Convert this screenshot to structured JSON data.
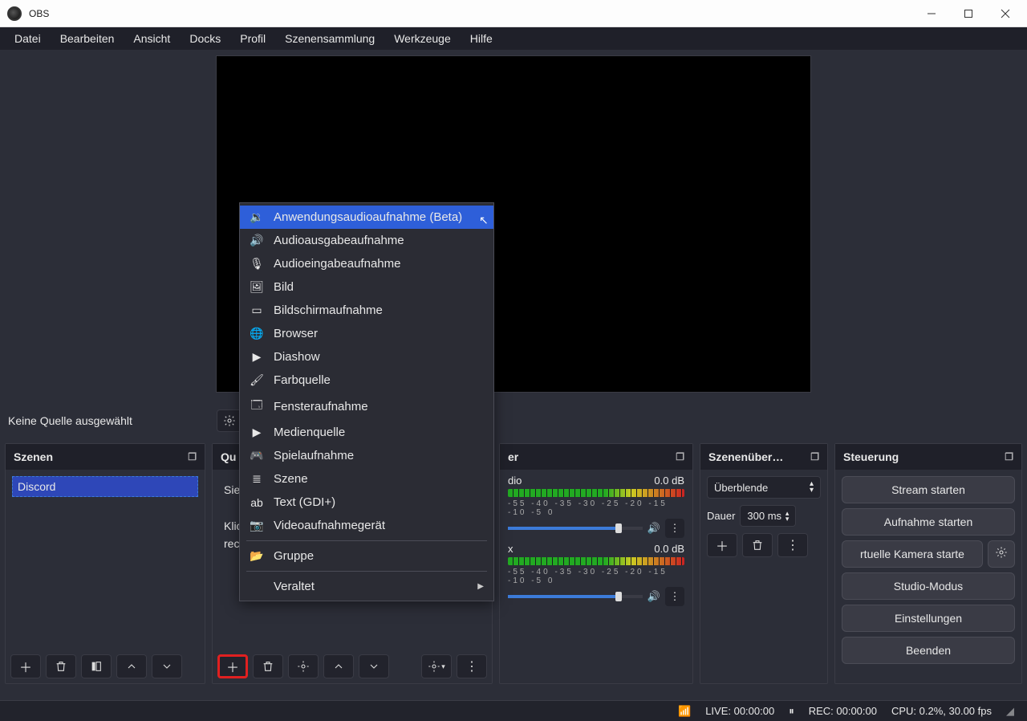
{
  "title": "OBS",
  "menubar": [
    "Datei",
    "Bearbeiten",
    "Ansicht",
    "Docks",
    "Profil",
    "Szenensammlung",
    "Werkzeuge",
    "Hilfe"
  ],
  "no_source_label": "Keine Quelle ausgewählt",
  "docks": {
    "scenes": {
      "title": "Szenen",
      "items": [
        "Discord"
      ]
    },
    "sources": {
      "title": "Qu",
      "hint_line1": "Sie",
      "hint_line2": "Klic",
      "hint_line3": "rec"
    },
    "mixer": {
      "title": "er",
      "channels": [
        {
          "name": "dio",
          "db": "0.0 dB",
          "ticks": "-55  -40  -35  -30  -25  -20  -15  -10  -5   0"
        },
        {
          "name": "x",
          "db": "0.0 dB",
          "ticks": "-55  -40  -35  -30  -25  -20  -15  -10  -5   0"
        }
      ]
    },
    "transitions": {
      "title": "Szenenüber…",
      "select": "Überblende",
      "duration_label": "Dauer",
      "duration_value": "300 ms"
    },
    "controls": {
      "title": "Steuerung",
      "buttons": [
        "Stream starten",
        "Aufnahme starten",
        "rtuelle Kamera starte",
        "Studio-Modus",
        "Einstellungen",
        "Beenden"
      ]
    }
  },
  "context_menu": [
    {
      "icon": "app-audio",
      "label": "Anwendungsaudioaufnahme (Beta)",
      "selected": true
    },
    {
      "icon": "speaker",
      "label": "Audioausgabeaufnahme"
    },
    {
      "icon": "mic",
      "label": "Audioeingabeaufnahme"
    },
    {
      "icon": "image",
      "label": "Bild"
    },
    {
      "icon": "display",
      "label": "Bildschirmaufnahme"
    },
    {
      "icon": "globe",
      "label": "Browser"
    },
    {
      "icon": "play",
      "label": "Diashow"
    },
    {
      "icon": "brush",
      "label": "Farbquelle"
    },
    {
      "icon": "window",
      "label": "Fensteraufnahme"
    },
    {
      "icon": "play",
      "label": "Medienquelle"
    },
    {
      "icon": "gamepad",
      "label": "Spielaufnahme"
    },
    {
      "icon": "list",
      "label": "Szene"
    },
    {
      "icon": "text",
      "label": "Text (GDI+)"
    },
    {
      "icon": "camera",
      "label": "Videoaufnahmegerät"
    },
    {
      "sep": true
    },
    {
      "icon": "folder",
      "label": "Gruppe"
    },
    {
      "sep": true
    },
    {
      "icon": "",
      "label": "Veraltet",
      "submenu": true
    }
  ],
  "status": {
    "live": "LIVE: 00:00:00",
    "rec": "REC: 00:00:00",
    "cpu": "CPU: 0.2%, 30.00 fps"
  }
}
